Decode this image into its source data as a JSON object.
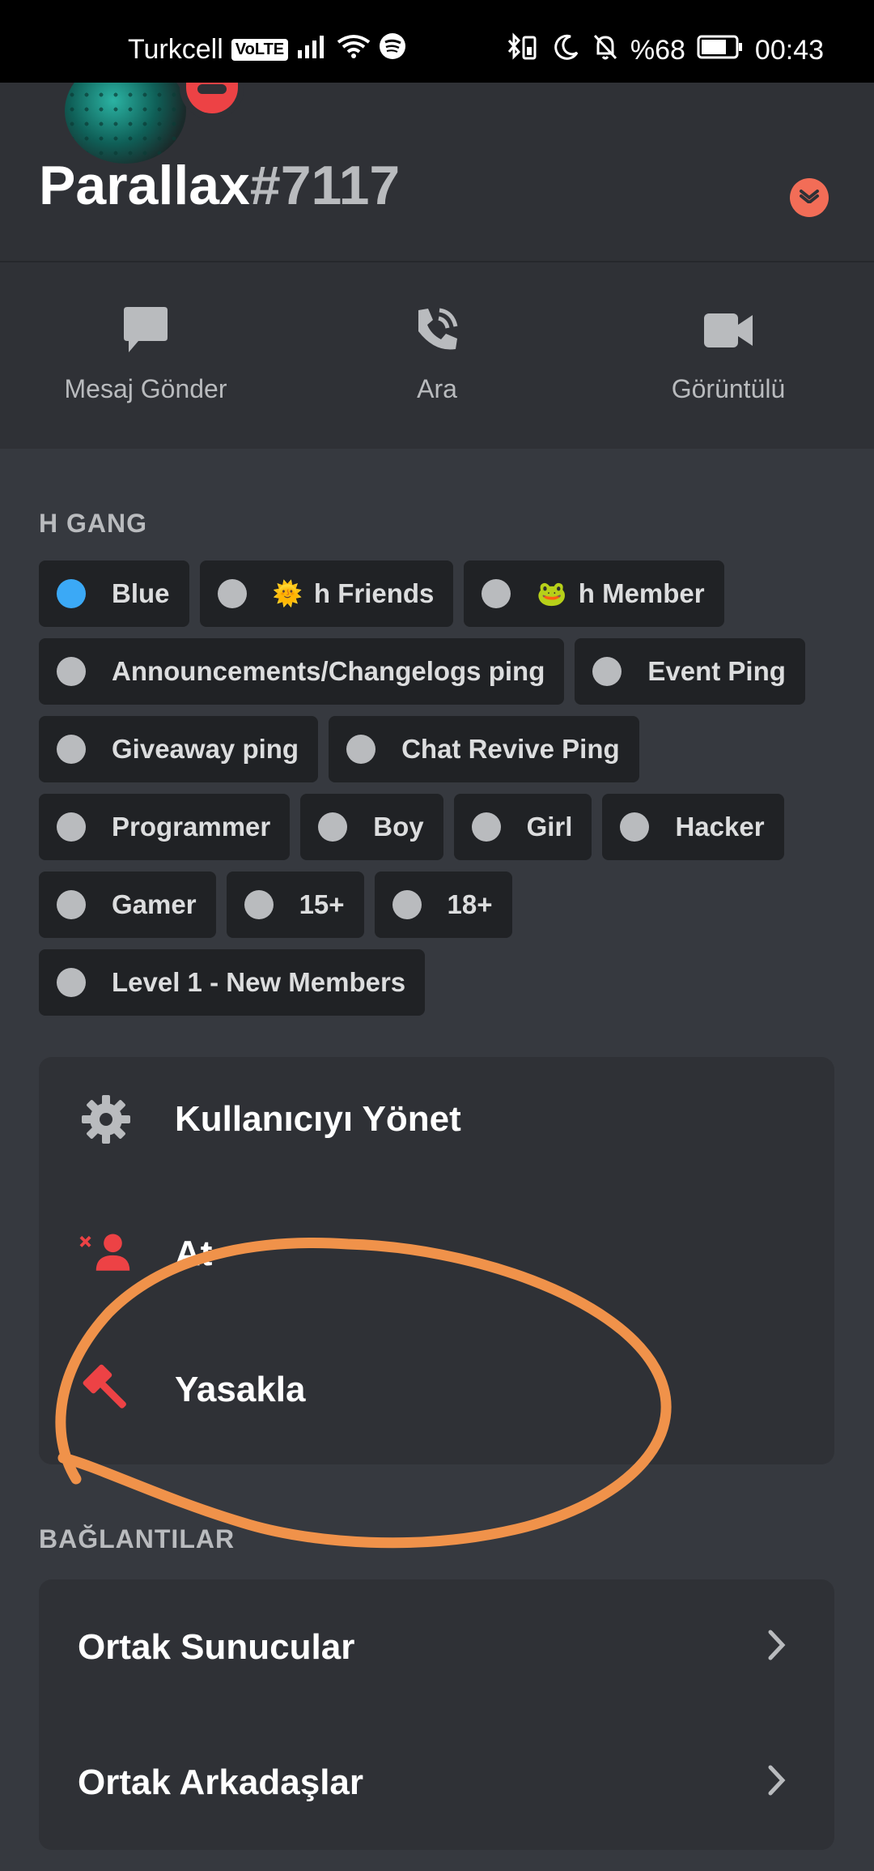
{
  "status_bar": {
    "carrier": "Turkcell",
    "volte": "VoLTE",
    "battery": "%68",
    "time": "00:43"
  },
  "profile": {
    "name": "Parallax",
    "discriminator": "#7117"
  },
  "actions": [
    {
      "label": "Mesaj Gönder",
      "icon": "chat-bubble-icon"
    },
    {
      "label": "Ara",
      "icon": "phone-call-icon"
    },
    {
      "label": "Görüntülü",
      "icon": "video-camera-icon"
    }
  ],
  "roles_section": {
    "title": "H GANG",
    "roles": [
      {
        "name": "Blue",
        "color": "#3ba9f6",
        "emoji": ""
      },
      {
        "name": "h Friends",
        "color": "#b9bbbe",
        "emoji": "🌞"
      },
      {
        "name": "h Member",
        "color": "#b9bbbe",
        "emoji": "🐸"
      },
      {
        "name": "Announcements/Changelogs ping",
        "color": "#b9bbbe",
        "emoji": ""
      },
      {
        "name": "Event Ping",
        "color": "#b9bbbe",
        "emoji": ""
      },
      {
        "name": "Giveaway ping",
        "color": "#b9bbbe",
        "emoji": ""
      },
      {
        "name": "Chat Revive Ping",
        "color": "#b9bbbe",
        "emoji": ""
      },
      {
        "name": "Programmer",
        "color": "#b9bbbe",
        "emoji": ""
      },
      {
        "name": "Boy",
        "color": "#b9bbbe",
        "emoji": ""
      },
      {
        "name": "Girl",
        "color": "#b9bbbe",
        "emoji": ""
      },
      {
        "name": "Hacker",
        "color": "#b9bbbe",
        "emoji": ""
      },
      {
        "name": "Gamer",
        "color": "#b9bbbe",
        "emoji": ""
      },
      {
        "name": "15+",
        "color": "#b9bbbe",
        "emoji": ""
      },
      {
        "name": "18+",
        "color": "#b9bbbe",
        "emoji": ""
      },
      {
        "name": "Level 1 - New Members",
        "color": "#b9bbbe",
        "emoji": ""
      }
    ]
  },
  "moderation": {
    "manage_user": "Kullanıcıyı Yönet",
    "kick": "At",
    "ban": "Yasakla"
  },
  "links_section": {
    "title": "BAĞLANTILAR",
    "mutual_servers": "Ortak Sunucular",
    "mutual_friends": "Ortak Arkadaşlar"
  },
  "colors": {
    "accent_danger": "#ed4245",
    "annotation": "#f0924a",
    "background": "#36393f",
    "card": "#2f3136"
  }
}
